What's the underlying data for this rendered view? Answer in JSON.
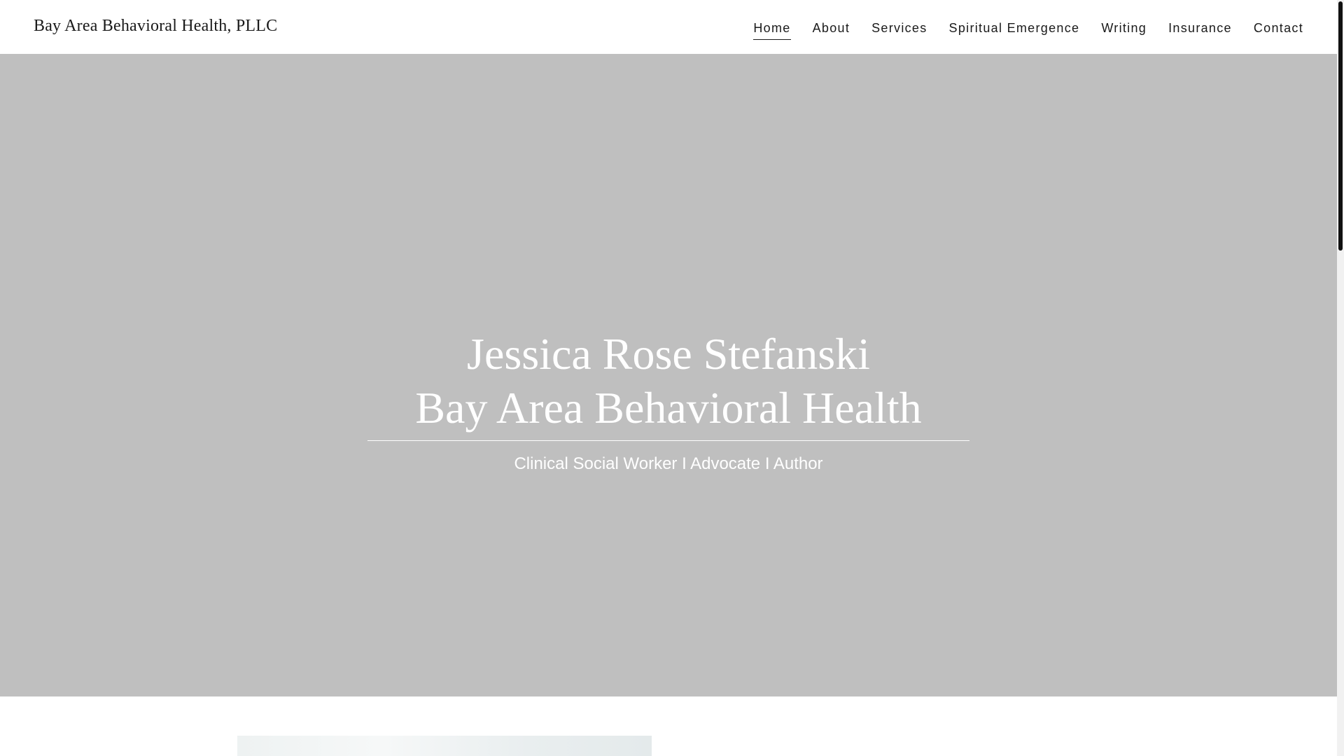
{
  "header": {
    "brand": "Bay Area Behavioral Health, PLLC",
    "nav": [
      {
        "label": "Home",
        "active": true
      },
      {
        "label": "About"
      },
      {
        "label": "Services"
      },
      {
        "label": "Spiritual Emergence"
      },
      {
        "label": "Writing"
      },
      {
        "label": "Insurance"
      },
      {
        "label": "Contact"
      }
    ]
  },
  "hero": {
    "title_line1": "Jessica Rose Stefanski",
    "title_line2": "Bay Area Behavioral Health",
    "subtitle": "Clinical Social Worker I Advocate I Author",
    "background": "#bfbfbf"
  },
  "colors": {
    "text": "#1a1a1a",
    "hero_text": "#ffffff"
  }
}
